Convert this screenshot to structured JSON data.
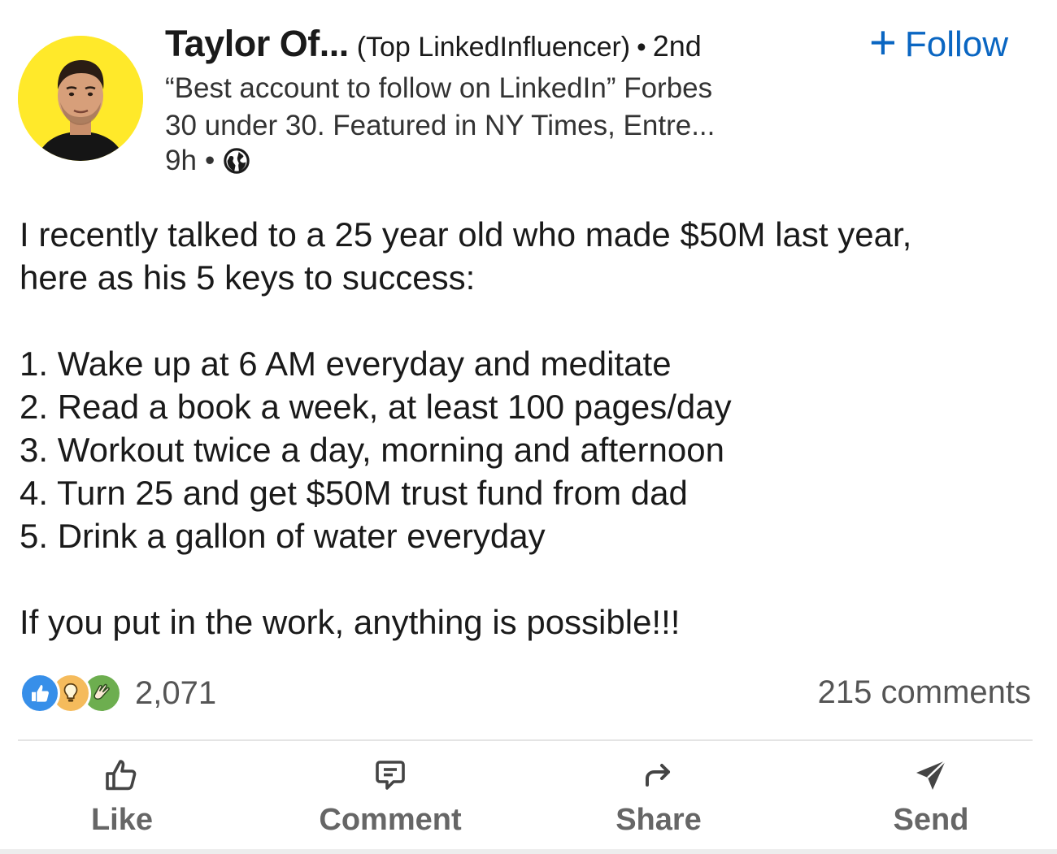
{
  "author": {
    "name": "Taylor Of...",
    "badge": "(Top LinkedInfluencer)",
    "separator": "•",
    "degree": "2nd",
    "headline_line1": "“Best account to follow on LinkedIn” Forbes",
    "headline_line2": "30 under 30. Featured in NY Times, Entre...",
    "time": "9h",
    "meta_separator": "•",
    "visibility_icon": "globe-icon",
    "avatar_bg": "#ffe92a"
  },
  "follow": {
    "plus": "+",
    "label": "Follow",
    "color": "#0a66c2"
  },
  "post": {
    "intro_line1": "I recently talked to a 25 year old who made $50M last year,",
    "intro_line2": "here as his 5 keys to success:",
    "list": [
      "1. Wake up at 6 AM everyday and meditate",
      "2. Read a book a week, at least 100 pages/day",
      "3. Workout twice a day, morning and afternoon",
      "4. Turn 25 and get $50M trust fund from dad",
      "5. Drink a gallon of water everyday"
    ],
    "closing": "If you put in the work, anything is possible!!!"
  },
  "social": {
    "reaction_icons": [
      "like-reaction-icon",
      "insightful-reaction-icon",
      "celebrate-reaction-icon"
    ],
    "reaction_count": "2,071",
    "comments": "215 comments"
  },
  "actions": {
    "like": "Like",
    "comment": "Comment",
    "share": "Share",
    "send": "Send"
  }
}
